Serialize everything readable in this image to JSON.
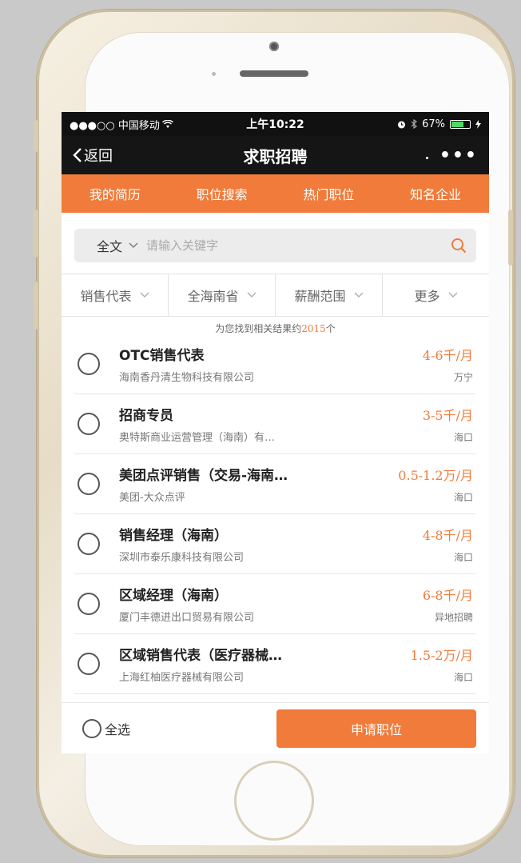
{
  "status_bar": {
    "carrier": "●●●○○ 中国移动",
    "time": "上午10:22",
    "battery": "67%",
    "battery_level": 0.67
  },
  "navbar": {
    "back_label": "返回",
    "title": "求职招聘",
    "more_label": "•••"
  },
  "tabs": [
    {
      "label": "我的简历"
    },
    {
      "label": "职位搜索"
    },
    {
      "label": "热门职位"
    },
    {
      "label": "知名企业"
    }
  ],
  "search": {
    "scope": "全文",
    "placeholder": "请输入关键字"
  },
  "filters": [
    {
      "label": "销售代表"
    },
    {
      "label": "全海南省"
    },
    {
      "label": "薪酬范围"
    },
    {
      "label": "更多"
    }
  ],
  "results": {
    "prefix": "为您找到相关结果约",
    "count": "2015",
    "suffix": "个"
  },
  "jobs": [
    {
      "title": "OTC销售代表",
      "company": "海南香丹清生物科技有限公司",
      "salary": "4-6千/月",
      "location": "万宁"
    },
    {
      "title": "招商专员",
      "company": "奥特斯商业运营管理（海南）有…",
      "salary": "3-5千/月",
      "location": "海口"
    },
    {
      "title": "美团点评销售（交易-海南…",
      "company": "美团-大众点评",
      "salary": "0.5-1.2万/月",
      "location": "海口"
    },
    {
      "title": "销售经理（海南）",
      "company": "深圳市泰乐康科技有限公司",
      "salary": "4-8千/月",
      "location": "海口"
    },
    {
      "title": "区域经理（海南）",
      "company": "厦门丰德进出口贸易有限公司",
      "salary": "6-8千/月",
      "location": "异地招聘"
    },
    {
      "title": "区域销售代表（医疗器械…",
      "company": "上海红柚医疗器械有限公司",
      "salary": "1.5-2万/月",
      "location": "海口"
    }
  ],
  "bottom": {
    "select_all": "全选",
    "apply": "申请职位"
  },
  "colors": {
    "accent": "#f07b3a",
    "header_bg": "#151515"
  }
}
